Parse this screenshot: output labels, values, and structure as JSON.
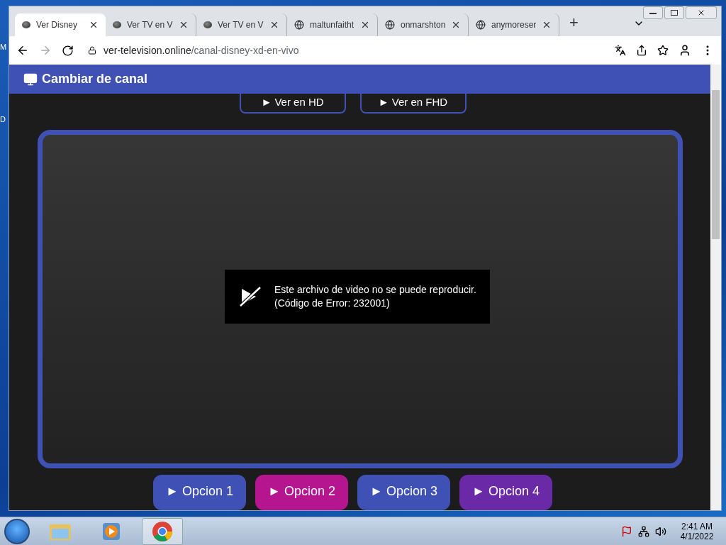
{
  "desktop": {
    "labels": [
      "M",
      "D"
    ]
  },
  "browser": {
    "tabs": [
      {
        "title": "Ver Disney",
        "kind": "ball",
        "selected": true
      },
      {
        "title": "Ver TV en V",
        "kind": "ball",
        "selected": false
      },
      {
        "title": "Ver TV en V",
        "kind": "ball",
        "selected": false
      },
      {
        "title": "maltunfaitht",
        "kind": "globe",
        "selected": false
      },
      {
        "title": "onmarshton",
        "kind": "globe",
        "selected": false
      },
      {
        "title": "anymoreser",
        "kind": "globe",
        "selected": false
      }
    ],
    "new_tab": "+",
    "url": {
      "domain": "ver-television.online",
      "path": "/canal-disney-xd-en-vivo"
    }
  },
  "page": {
    "header": "Cambiar de canal",
    "quality_buttons": [
      "► Ver en HD",
      "► Ver en FHD"
    ],
    "player_error": {
      "line_1": "Este archivo de video no se puede reproducir.",
      "line_2": "(Código de Error: 232001)"
    },
    "options": [
      {
        "label": "► Opcion 1",
        "color": "#3f51b5"
      },
      {
        "label": "► Opcion 2",
        "color": "#b5168f"
      },
      {
        "label": "► Opcion 3",
        "color": "#3f51b5"
      },
      {
        "label": "► Opcion 4",
        "color": "#6a2aa8"
      }
    ]
  },
  "taskbar": {
    "time": "2:41 AM",
    "date": "4/1/2022"
  }
}
